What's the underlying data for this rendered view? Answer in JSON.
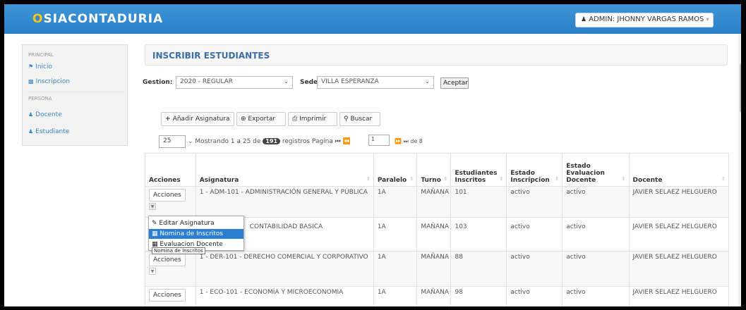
{
  "navbar": {
    "brand": "SIACONTADURIA",
    "brand_mark": "O",
    "user_label": "ADMIN: JHONNY VARGAS RAMOS",
    "user_caret": "▾"
  },
  "sidebar": {
    "section_principal": "PRINCIPAL",
    "section_persona": "PERSONA",
    "items": [
      {
        "label": "Inicio",
        "icon": "home-icon"
      },
      {
        "label": "Inscripcion",
        "icon": "group-icon"
      },
      {
        "label": "Docente",
        "icon": "user-icon"
      },
      {
        "label": "Estudiante",
        "icon": "user-icon"
      }
    ]
  },
  "page": {
    "title": "INSCRIBIR ESTUDIANTES"
  },
  "filters": {
    "gestion_label": "Gestion:",
    "gestion_value": "2020 - REGULAR",
    "sede_label": "Sede:",
    "sede_value": "VILLA ESPERANZA",
    "accept_label": "Aceptar"
  },
  "toolbar": {
    "add_label": "Añadir Asignatura",
    "export_label": "Exportar",
    "print_label": "Imprimir",
    "search_label": "Buscar"
  },
  "pager": {
    "page_length": "25",
    "info_prefix": "Mostrando 1 a 25 de",
    "total": "191",
    "info_suffix": "registros Pagina",
    "current_page": "1",
    "of_text": "de 8"
  },
  "table": {
    "headers": [
      "Acciones",
      "Asignatura",
      "Paralelo",
      "Turno",
      "Estudiantes Inscritos",
      "Estado Inscripcion",
      "Estado Evaluacion Docente",
      "Docente"
    ],
    "action_label": "Acciones",
    "rows": [
      {
        "asignatura": "1 - ADM-101 - ADMINISTRACIÓN GENERAL Y PÚBLICA",
        "paralelo": "1A",
        "turno": "MAÑANA",
        "inscritos": "101",
        "estado_inscripcion": "activo",
        "estado_evaluacion": "activo",
        "docente": "JAVIER SELAEZ HELGUERO"
      },
      {
        "asignatura": "CONTABILIDAD BASICA",
        "paralelo": "1A",
        "turno": "MAÑANA",
        "inscritos": "103",
        "estado_inscripcion": "activo",
        "estado_evaluacion": "activo",
        "docente": "JAVIER SELAEZ HELGUERO"
      },
      {
        "asignatura": "1 - DER-101 - DERECHO COMERCIAL Y CORPORATIVO",
        "paralelo": "1A",
        "turno": "MAÑANA",
        "inscritos": "88",
        "estado_inscripcion": "activo",
        "estado_evaluacion": "activo",
        "docente": "JAVIER SELAEZ HELGUERO"
      },
      {
        "asignatura": "1 - ECO-101 - ECONOMÍA Y MICROECONOMIA",
        "paralelo": "1A",
        "turno": "MAÑANA",
        "inscritos": "98",
        "estado_inscripcion": "activo",
        "estado_evaluacion": "activo",
        "docente": "JAVIER SELAEZ HELGUERO"
      }
    ]
  },
  "dropdown": {
    "items": [
      "Editar Asignatura",
      "Nomina de Inscritos",
      "Evaluacion Docente"
    ],
    "tooltip": "Nomina de Inscritos"
  },
  "colors": {
    "navbar": "#2a80c8",
    "accent": "#3a86c8",
    "selected": "#2c7dd4",
    "brand_mark": "#f5c518"
  }
}
